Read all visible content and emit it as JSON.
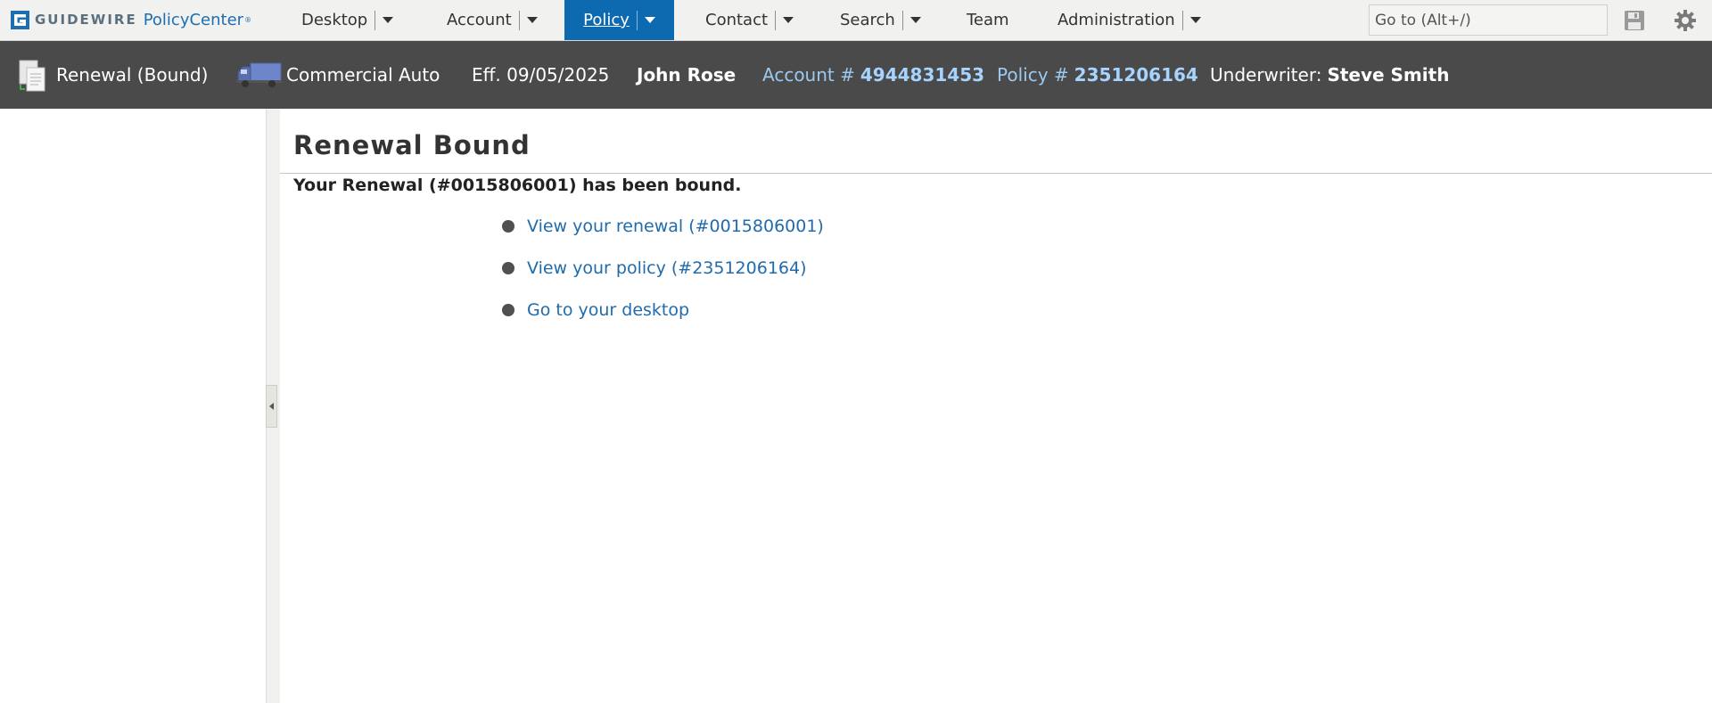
{
  "brand": {
    "name": "GUIDEWIRE",
    "product": "PolicyCenter",
    "mark": "®"
  },
  "nav": {
    "items": [
      {
        "label": "Desktop",
        "has_menu": true,
        "active": false
      },
      {
        "label": "Account",
        "has_menu": true,
        "active": false
      },
      {
        "label": "Policy",
        "has_menu": true,
        "active": true
      },
      {
        "label": "Contact",
        "has_menu": true,
        "active": false
      },
      {
        "label": "Search",
        "has_menu": true,
        "active": false
      },
      {
        "label": "Team",
        "has_menu": false,
        "active": false
      },
      {
        "label": "Administration",
        "has_menu": true,
        "active": false
      }
    ],
    "goto_placeholder": "Go to (Alt+/)",
    "icons": [
      "save-icon",
      "settings-gear-icon"
    ]
  },
  "info_bar": {
    "job_status": "Renewal (Bound)",
    "line_of_business": "Commercial Auto",
    "effective": "Eff. 09/05/2025",
    "insured": "John Rose",
    "account_label": "Account #",
    "account_number": "4944831453",
    "policy_label": "Policy #",
    "policy_number": "2351206164",
    "underwriter_label": "Underwriter:",
    "underwriter": "Steve Smith"
  },
  "main": {
    "title": "Renewal Bound",
    "message": "Your Renewal (#0015806001) has been bound.",
    "links": [
      "View your renewal (#0015806001)",
      "View your policy (#2351206164)",
      "Go to your desktop"
    ]
  },
  "colors": {
    "nav_active": "#0e6ab0",
    "info_bar_bg": "#4a4a4a",
    "link": "#1f6bac",
    "info_highlight": "#a7d4ff"
  }
}
